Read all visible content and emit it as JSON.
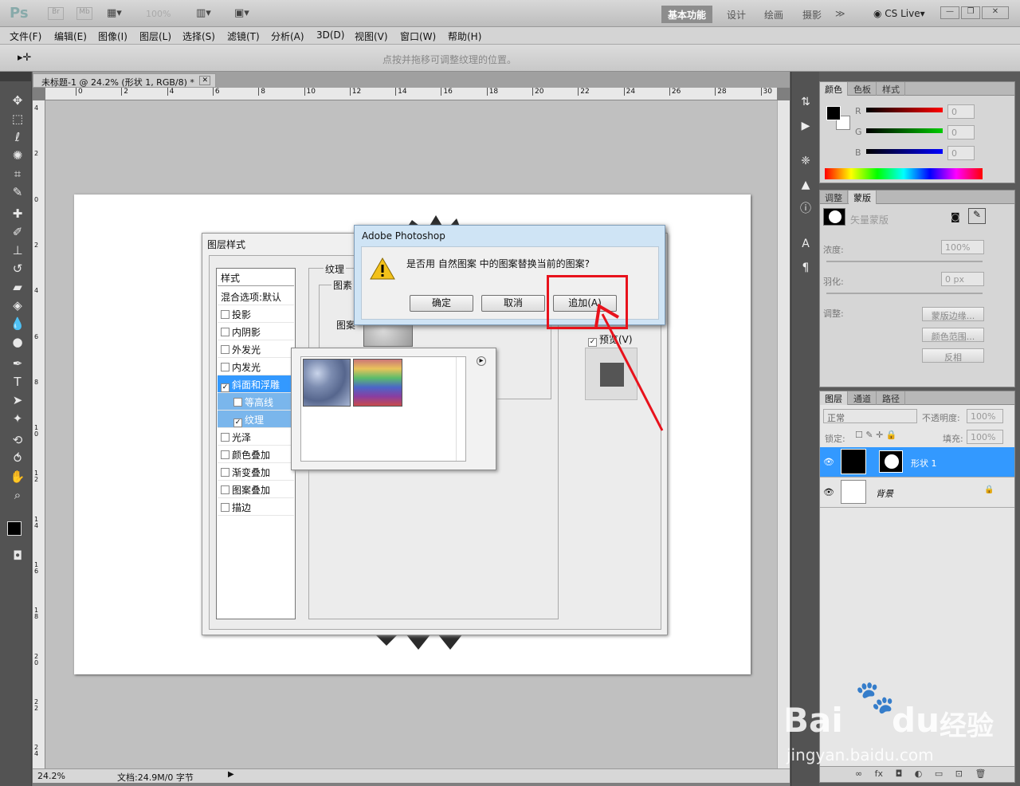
{
  "app": {
    "logo": "Ps",
    "logo_btns": [
      "Br",
      "Mb"
    ],
    "zoom": "100%",
    "workspaces": [
      "基本功能",
      "设计",
      "绘画",
      "摄影"
    ],
    "more": "≫",
    "cslive": "CS Live▾",
    "win_controls": [
      "—",
      "❐",
      "✕"
    ]
  },
  "menu": [
    "文件(F)",
    "编辑(E)",
    "图像(I)",
    "图层(L)",
    "选择(S)",
    "滤镜(T)",
    "分析(A)",
    "3D(D)",
    "视图(V)",
    "窗口(W)",
    "帮助(H)"
  ],
  "options": {
    "tool_glyph": "▸✛",
    "hint": "点按并拖移可调整纹理的位置。"
  },
  "document": {
    "tab_title": "未标题-1 @ 24.2% (形状 1, RGB/8) *",
    "close": "✕",
    "ruler_h": [
      "0",
      "2",
      "4",
      "6",
      "8",
      "10",
      "12",
      "14",
      "16",
      "18",
      "20",
      "22",
      "24",
      "26",
      "28",
      "30"
    ],
    "ruler_v": [
      "4",
      "2",
      "0",
      "2",
      "4",
      "6",
      "8",
      "1 0",
      "1 2",
      "1 4",
      "1 6",
      "1 8",
      "2 0",
      "2 2",
      "2 4"
    ],
    "status_zoom": "24.2%",
    "status_doc": "文档:24.9M/0 字节"
  },
  "layer_style": {
    "title": "图层样式",
    "styles_header": "样式",
    "blend": "混合选项:默认",
    "items": [
      {
        "label": "投影",
        "checked": false
      },
      {
        "label": "内阴影",
        "checked": false
      },
      {
        "label": "外发光",
        "checked": false
      },
      {
        "label": "内发光",
        "checked": false
      },
      {
        "label": "斜面和浮雕",
        "checked": true
      },
      {
        "label": "等高线",
        "checked": false
      },
      {
        "label": "纹理",
        "checked": true
      },
      {
        "label": "光泽",
        "checked": false
      },
      {
        "label": "颜色叠加",
        "checked": false
      },
      {
        "label": "渐变叠加",
        "checked": false
      },
      {
        "label": "图案叠加",
        "checked": false
      },
      {
        "label": "描边",
        "checked": false
      }
    ],
    "texture_group": "纹理",
    "pattern_group": "图素",
    "pattern_label": "图案",
    "preview_label": "预览(V)"
  },
  "alert": {
    "title": "Adobe Photoshop",
    "message": "是否用 自然图案 中的图案替换当前的图案?",
    "ok": "确定",
    "cancel": "取消",
    "append": "追加(A)"
  },
  "color_panel": {
    "tabs": [
      "颜色",
      "色板",
      "样式"
    ],
    "channels": [
      "R",
      "G",
      "B"
    ],
    "values": [
      "0",
      "0",
      "0"
    ]
  },
  "masks_panel": {
    "tabs": [
      "调整",
      "蒙版"
    ],
    "label": "矢量蒙版",
    "density_label": "浓度:",
    "density": "100%",
    "feather_label": "羽化:",
    "feather": "0 px",
    "refine_label": "调整:",
    "btn_edge": "蒙版边缘...",
    "btn_range": "颜色范围...",
    "btn_invert": "反相"
  },
  "layers_panel": {
    "tabs": [
      "图层",
      "通道",
      "路径"
    ],
    "blend_mode": "正常",
    "opacity_label": "不透明度:",
    "opacity": "100%",
    "lock_label": "锁定:",
    "fill_label": "填充:",
    "fill": "100%",
    "layers": [
      {
        "name": "形状 1",
        "selected": true
      },
      {
        "name": "背景",
        "selected": false
      }
    ],
    "footer": [
      "∞",
      "fx",
      "◘",
      "◐",
      "▭",
      "⊡",
      "🗑"
    ]
  },
  "watermark": {
    "brand": "Bai",
    "brand2": "du",
    "brand3": "经验",
    "url": "jingyan.baidu.com"
  },
  "colors": {
    "accent": "#3399ff",
    "highlight_box": "#e8121c",
    "arrow": "#e8121c"
  }
}
